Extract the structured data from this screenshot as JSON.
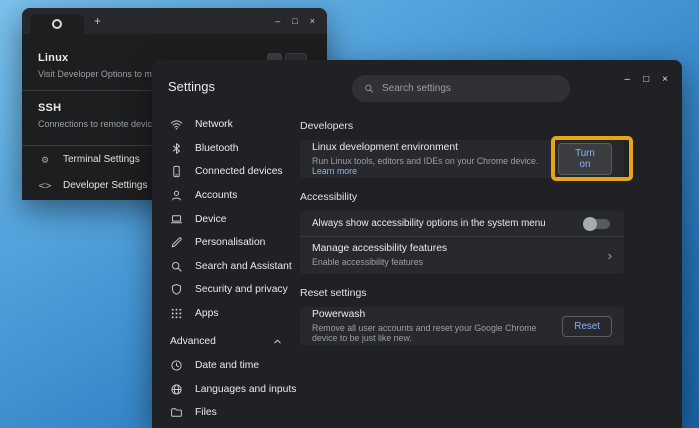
{
  "terminal_window": {
    "tab_new_label": "+",
    "controls": {
      "minimize": "–",
      "maximize": "□",
      "close": "×"
    },
    "sections": [
      {
        "title": "Linux",
        "subtitle": "Visit Developer Options to manage Linux"
      },
      {
        "title": "SSH",
        "subtitle": "Connections to remote devices will appear h"
      }
    ],
    "menu": [
      {
        "icon": "⚙",
        "label": "Terminal Settings"
      },
      {
        "icon": "<>",
        "label": "Developer Settings"
      }
    ]
  },
  "settings": {
    "title": "Settings",
    "search_placeholder": "Search settings",
    "controls": {
      "minimize": "–",
      "maximize": "□",
      "close": "×"
    },
    "sidebar": [
      {
        "label": "Network"
      },
      {
        "label": "Bluetooth"
      },
      {
        "label": "Connected devices"
      },
      {
        "label": "Accounts"
      },
      {
        "label": "Device"
      },
      {
        "label": "Personalisation"
      },
      {
        "label": "Search and Assistant"
      },
      {
        "label": "Security and privacy"
      },
      {
        "label": "Apps"
      },
      {
        "label": "Advanced"
      },
      {
        "label": "Date and time"
      },
      {
        "label": "Languages and inputs"
      },
      {
        "label": "Files"
      }
    ],
    "developers": {
      "heading": "Developers",
      "linux_row": {
        "title": "Linux development environment",
        "subtitle": "Run Linux tools, editors and IDEs on your Chrome device. ",
        "link": "Learn more",
        "button": "Turn on"
      }
    },
    "accessibility": {
      "heading": "Accessibility",
      "toggle_row": {
        "title": "Always show accessibility options in the system menu"
      },
      "manage_row": {
        "title": "Manage accessibility features",
        "subtitle": "Enable accessibility features",
        "chevron": "›"
      }
    },
    "reset": {
      "heading": "Reset settings",
      "powerwash_row": {
        "title": "Powerwash",
        "subtitle": "Remove all user accounts and reset your Google Chrome device to be just like new.",
        "button": "Reset"
      }
    },
    "colors": {
      "accent": "#8ab4f8",
      "highlight": "#eaa41c"
    }
  }
}
